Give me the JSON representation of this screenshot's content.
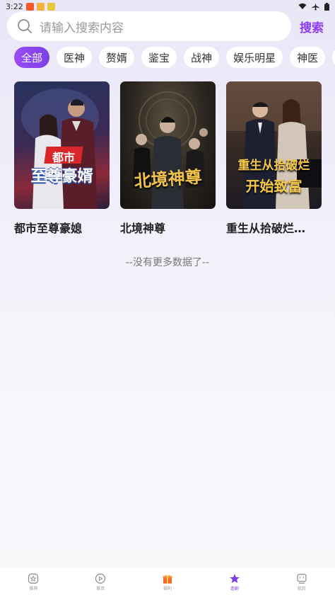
{
  "status_bar": {
    "time": "3:22"
  },
  "search": {
    "placeholder": "请输入搜索内容",
    "button_label": "搜索"
  },
  "categories": [
    "全部",
    "医神",
    "赘婿",
    "鉴宝",
    "战神",
    "娱乐明星",
    "神医",
    "重"
  ],
  "dramas": [
    {
      "title": "都市至尊豪媳",
      "poster_badge": "都市",
      "poster_text": "至尊豪婿"
    },
    {
      "title": "北境神尊",
      "poster_text": "北境神尊"
    },
    {
      "title": "重生从拾破烂…",
      "poster_text": "重生从拾破烂",
      "poster_text_2": "开始致富"
    }
  ],
  "footer_text": "--没有更多数据了--",
  "bottom_nav": [
    {
      "label": "推荐",
      "icon": "star-circle-icon"
    },
    {
      "label": "首页",
      "icon": "play-circle-icon"
    },
    {
      "label": "福利",
      "icon": "gift-icon"
    },
    {
      "label": "追剧",
      "icon": "star-icon"
    },
    {
      "label": "我的",
      "icon": "chat-box-icon"
    }
  ],
  "colors": {
    "accent": "#8a3bf2",
    "active_chip": "#7b3ee8"
  }
}
